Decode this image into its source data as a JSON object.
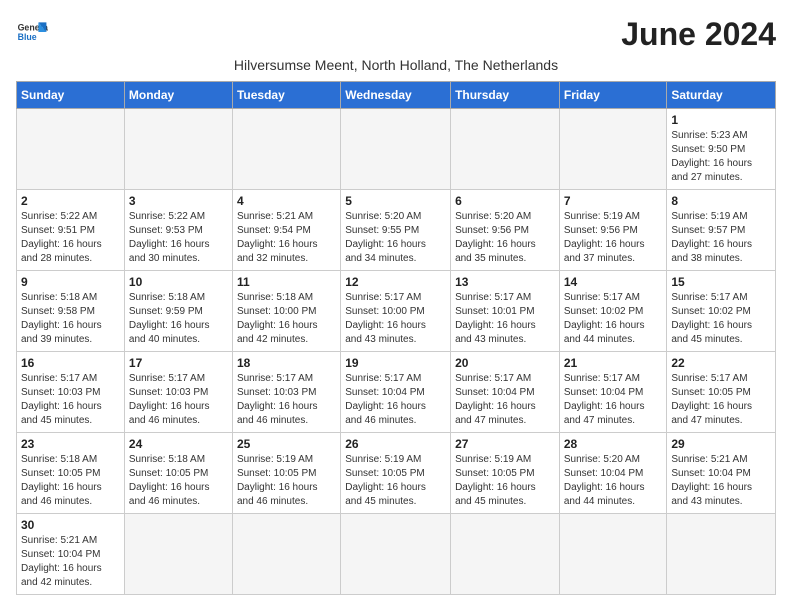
{
  "header": {
    "logo_line1": "General",
    "logo_line2": "Blue",
    "month_year": "June 2024",
    "subtitle": "Hilversumse Meent, North Holland, The Netherlands"
  },
  "weekdays": [
    "Sunday",
    "Monday",
    "Tuesday",
    "Wednesday",
    "Thursday",
    "Friday",
    "Saturday"
  ],
  "weeks": [
    [
      {
        "day": "",
        "info": ""
      },
      {
        "day": "",
        "info": ""
      },
      {
        "day": "",
        "info": ""
      },
      {
        "day": "",
        "info": ""
      },
      {
        "day": "",
        "info": ""
      },
      {
        "day": "",
        "info": ""
      },
      {
        "day": "1",
        "info": "Sunrise: 5:23 AM\nSunset: 9:50 PM\nDaylight: 16 hours\nand 27 minutes."
      }
    ],
    [
      {
        "day": "2",
        "info": "Sunrise: 5:22 AM\nSunset: 9:51 PM\nDaylight: 16 hours\nand 28 minutes."
      },
      {
        "day": "3",
        "info": "Sunrise: 5:22 AM\nSunset: 9:53 PM\nDaylight: 16 hours\nand 30 minutes."
      },
      {
        "day": "4",
        "info": "Sunrise: 5:21 AM\nSunset: 9:54 PM\nDaylight: 16 hours\nand 32 minutes."
      },
      {
        "day": "5",
        "info": "Sunrise: 5:20 AM\nSunset: 9:55 PM\nDaylight: 16 hours\nand 34 minutes."
      },
      {
        "day": "6",
        "info": "Sunrise: 5:20 AM\nSunset: 9:56 PM\nDaylight: 16 hours\nand 35 minutes."
      },
      {
        "day": "7",
        "info": "Sunrise: 5:19 AM\nSunset: 9:56 PM\nDaylight: 16 hours\nand 37 minutes."
      },
      {
        "day": "8",
        "info": "Sunrise: 5:19 AM\nSunset: 9:57 PM\nDaylight: 16 hours\nand 38 minutes."
      }
    ],
    [
      {
        "day": "9",
        "info": "Sunrise: 5:18 AM\nSunset: 9:58 PM\nDaylight: 16 hours\nand 39 minutes."
      },
      {
        "day": "10",
        "info": "Sunrise: 5:18 AM\nSunset: 9:59 PM\nDaylight: 16 hours\nand 40 minutes."
      },
      {
        "day": "11",
        "info": "Sunrise: 5:18 AM\nSunset: 10:00 PM\nDaylight: 16 hours\nand 42 minutes."
      },
      {
        "day": "12",
        "info": "Sunrise: 5:17 AM\nSunset: 10:00 PM\nDaylight: 16 hours\nand 43 minutes."
      },
      {
        "day": "13",
        "info": "Sunrise: 5:17 AM\nSunset: 10:01 PM\nDaylight: 16 hours\nand 43 minutes."
      },
      {
        "day": "14",
        "info": "Sunrise: 5:17 AM\nSunset: 10:02 PM\nDaylight: 16 hours\nand 44 minutes."
      },
      {
        "day": "15",
        "info": "Sunrise: 5:17 AM\nSunset: 10:02 PM\nDaylight: 16 hours\nand 45 minutes."
      }
    ],
    [
      {
        "day": "16",
        "info": "Sunrise: 5:17 AM\nSunset: 10:03 PM\nDaylight: 16 hours\nand 45 minutes."
      },
      {
        "day": "17",
        "info": "Sunrise: 5:17 AM\nSunset: 10:03 PM\nDaylight: 16 hours\nand 46 minutes."
      },
      {
        "day": "18",
        "info": "Sunrise: 5:17 AM\nSunset: 10:03 PM\nDaylight: 16 hours\nand 46 minutes."
      },
      {
        "day": "19",
        "info": "Sunrise: 5:17 AM\nSunset: 10:04 PM\nDaylight: 16 hours\nand 46 minutes."
      },
      {
        "day": "20",
        "info": "Sunrise: 5:17 AM\nSunset: 10:04 PM\nDaylight: 16 hours\nand 47 minutes."
      },
      {
        "day": "21",
        "info": "Sunrise: 5:17 AM\nSunset: 10:04 PM\nDaylight: 16 hours\nand 47 minutes."
      },
      {
        "day": "22",
        "info": "Sunrise: 5:17 AM\nSunset: 10:05 PM\nDaylight: 16 hours\nand 47 minutes."
      }
    ],
    [
      {
        "day": "23",
        "info": "Sunrise: 5:18 AM\nSunset: 10:05 PM\nDaylight: 16 hours\nand 46 minutes."
      },
      {
        "day": "24",
        "info": "Sunrise: 5:18 AM\nSunset: 10:05 PM\nDaylight: 16 hours\nand 46 minutes."
      },
      {
        "day": "25",
        "info": "Sunrise: 5:19 AM\nSunset: 10:05 PM\nDaylight: 16 hours\nand 46 minutes."
      },
      {
        "day": "26",
        "info": "Sunrise: 5:19 AM\nSunset: 10:05 PM\nDaylight: 16 hours\nand 45 minutes."
      },
      {
        "day": "27",
        "info": "Sunrise: 5:19 AM\nSunset: 10:05 PM\nDaylight: 16 hours\nand 45 minutes."
      },
      {
        "day": "28",
        "info": "Sunrise: 5:20 AM\nSunset: 10:04 PM\nDaylight: 16 hours\nand 44 minutes."
      },
      {
        "day": "29",
        "info": "Sunrise: 5:21 AM\nSunset: 10:04 PM\nDaylight: 16 hours\nand 43 minutes."
      }
    ],
    [
      {
        "day": "30",
        "info": "Sunrise: 5:21 AM\nSunset: 10:04 PM\nDaylight: 16 hours\nand 42 minutes."
      },
      {
        "day": "",
        "info": ""
      },
      {
        "day": "",
        "info": ""
      },
      {
        "day": "",
        "info": ""
      },
      {
        "day": "",
        "info": ""
      },
      {
        "day": "",
        "info": ""
      },
      {
        "day": "",
        "info": ""
      }
    ]
  ]
}
